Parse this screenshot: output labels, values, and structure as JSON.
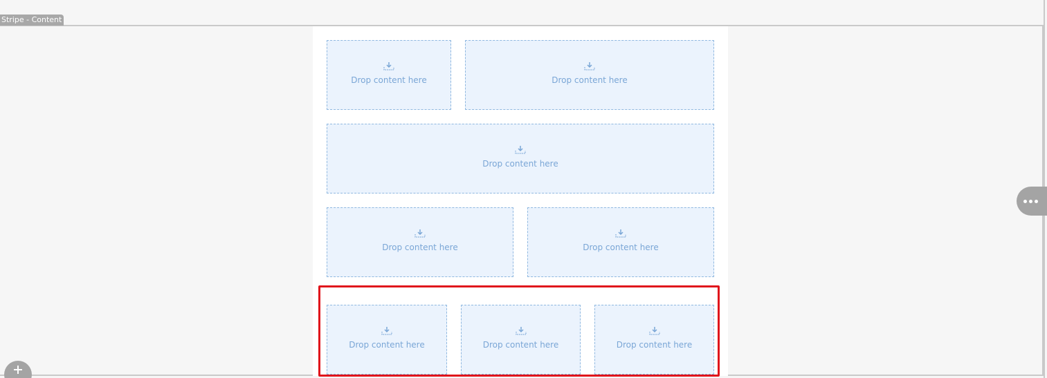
{
  "stripe": {
    "tab_label": "Stripe - Content"
  },
  "colors": {
    "canvas_bg": "#f6f6f6",
    "content_bg": "#ffffff",
    "dropzone_bg": "#ebf3fd",
    "dropzone_border": "#8fb8e0",
    "dropzone_text": "#7aa6d6",
    "selection": "#e0131b",
    "control_gray": "#a4a4a4"
  },
  "icons": {
    "dropzone": "drop-download-icon",
    "options": "more-horizontal-icon",
    "add": "plus-icon"
  },
  "rows": [
    {
      "cells": [
        {
          "label": "Drop content here"
        },
        {
          "label": "Drop content here"
        }
      ]
    },
    {
      "cells": [
        {
          "label": "Drop content here"
        }
      ]
    },
    {
      "cells": [
        {
          "label": "Drop content here"
        },
        {
          "label": "Drop content here"
        }
      ]
    },
    {
      "selected": true,
      "cells": [
        {
          "label": "Drop content here"
        },
        {
          "label": "Drop content here"
        },
        {
          "label": "Drop content here"
        }
      ]
    }
  ]
}
